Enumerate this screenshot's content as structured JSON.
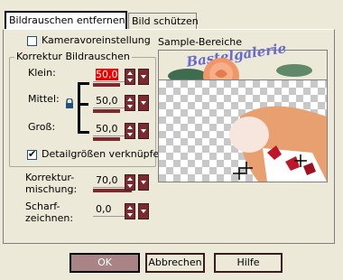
{
  "tabs": [
    "Bildrauschen entfernen",
    "Bild schützen"
  ],
  "kamera_label": "Kameravoreinstellung",
  "group_label": "Korrektur Bildrauschen",
  "klein": {
    "label": "Klein:",
    "value": "50,0"
  },
  "mittel": {
    "label": "Mittel:",
    "value": "50,0"
  },
  "gross": {
    "label": "Groß:",
    "value": "50,0"
  },
  "detail_label": "Detailgrößen verknüpfen",
  "korrektur": {
    "label1": "Korrektur-",
    "label2": "mischung:",
    "value": "70,0"
  },
  "scharf": {
    "label1": "Scharf-",
    "label2": "zeichnen:",
    "value": "0,0"
  },
  "sample_label": "Sample-Bereiche",
  "watermark_text": "Bastelgalerie",
  "buttons": {
    "ok": "OK",
    "cancel": "Abbrechen",
    "help": "Hilfe"
  }
}
